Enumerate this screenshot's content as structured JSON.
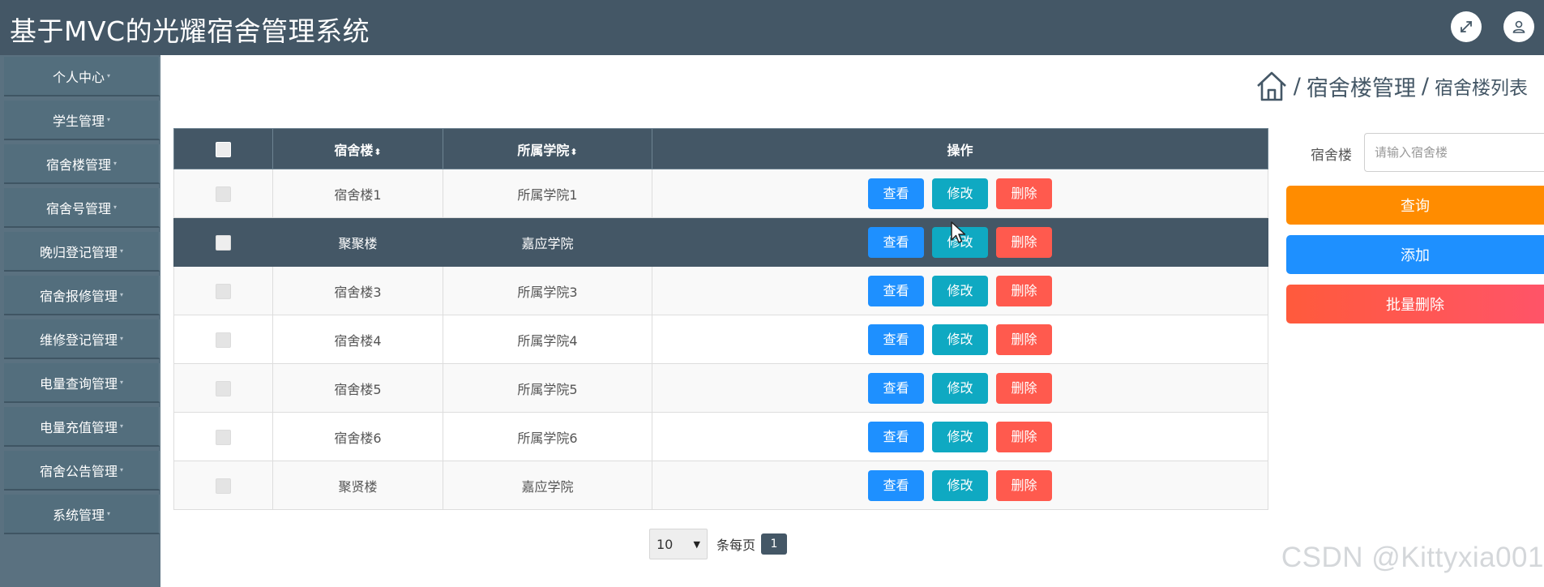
{
  "app": {
    "title": "基于MVC的光耀宿舍管理系统"
  },
  "header": {
    "icons": [
      "expand-icon",
      "user-icon"
    ]
  },
  "sidebar": {
    "items": [
      {
        "label": "个人中心"
      },
      {
        "label": "学生管理"
      },
      {
        "label": "宿舍楼管理"
      },
      {
        "label": "宿舍号管理"
      },
      {
        "label": "晚归登记管理"
      },
      {
        "label": "宿舍报修管理"
      },
      {
        "label": "维修登记管理"
      },
      {
        "label": "电量查询管理"
      },
      {
        "label": "电量充值管理"
      },
      {
        "label": "宿舍公告管理"
      },
      {
        "label": "系统管理"
      }
    ]
  },
  "breadcrumb": {
    "separator": "/",
    "section": "宿舍楼管理",
    "page": "宿舍楼列表"
  },
  "table": {
    "columns": {
      "building": "宿舍楼",
      "college": "所属学院",
      "actions": "操作"
    },
    "sort_icon": "⬍",
    "rows": [
      {
        "building": "宿舍楼1",
        "college": "所属学院1"
      },
      {
        "building": "聚聚楼",
        "college": "嘉应学院"
      },
      {
        "building": "宿舍楼3",
        "college": "所属学院3"
      },
      {
        "building": "宿舍楼4",
        "college": "所属学院4"
      },
      {
        "building": "宿舍楼5",
        "college": "所属学院5"
      },
      {
        "building": "宿舍楼6",
        "college": "所属学院6"
      },
      {
        "building": "聚贤楼",
        "college": "嘉应学院"
      }
    ],
    "actions": {
      "view": "查看",
      "edit": "修改",
      "delete": "删除"
    }
  },
  "pagination": {
    "page_size": "10",
    "per_page_label": "条每页",
    "current_page": "1"
  },
  "search": {
    "label": "宿舍楼",
    "placeholder": "请输入宿舍楼",
    "query_label": "查询",
    "add_label": "添加",
    "batch_delete_label": "批量删除"
  },
  "watermark": "CSDN @Kittyxia001",
  "colors": {
    "header": "#445766",
    "sidebar": "#5a7180",
    "view": "#1e90ff",
    "edit": "#0fa9c2",
    "delete": "#ff5a4e",
    "query": "#ff8c00",
    "add": "#1e90ff",
    "batch_delete": "#ff5a3c"
  }
}
